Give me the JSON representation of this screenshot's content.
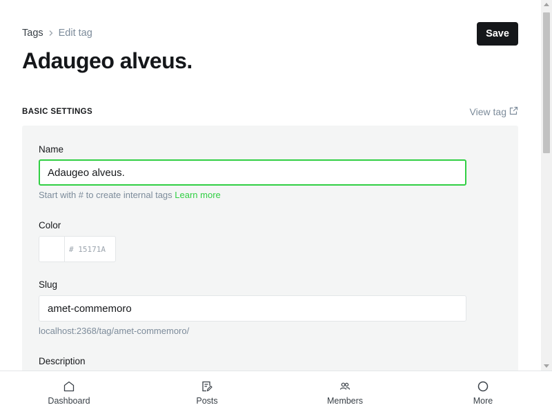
{
  "breadcrumb": {
    "root": "Tags",
    "current": "Edit tag"
  },
  "page_title": "Adaugeo alveus.",
  "toolbar": {
    "save_label": "Save"
  },
  "section": {
    "heading": "BASIC SETTINGS",
    "view_tag_label": "View tag"
  },
  "form": {
    "name": {
      "label": "Name",
      "value": "Adaugeo alveus.",
      "hint": "Start with # to create internal tags",
      "hint_link": "Learn more"
    },
    "color": {
      "label": "Color",
      "hash": "#",
      "placeholder": "15171A"
    },
    "slug": {
      "label": "Slug",
      "value": "amet-commemoro",
      "url_preview": "localhost:2368/tag/amet-commemoro/"
    },
    "description": {
      "label": "Description"
    }
  },
  "bottom_nav": [
    {
      "label": "Dashboard",
      "icon": "home-icon"
    },
    {
      "label": "Posts",
      "icon": "posts-icon"
    },
    {
      "label": "Members",
      "icon": "members-icon"
    },
    {
      "label": "More",
      "icon": "circle-icon"
    }
  ],
  "colors": {
    "accent_green": "#30cf43",
    "primary_dark": "#15171a",
    "muted": "#7c8b9a",
    "panel_bg": "#f4f5f5"
  }
}
